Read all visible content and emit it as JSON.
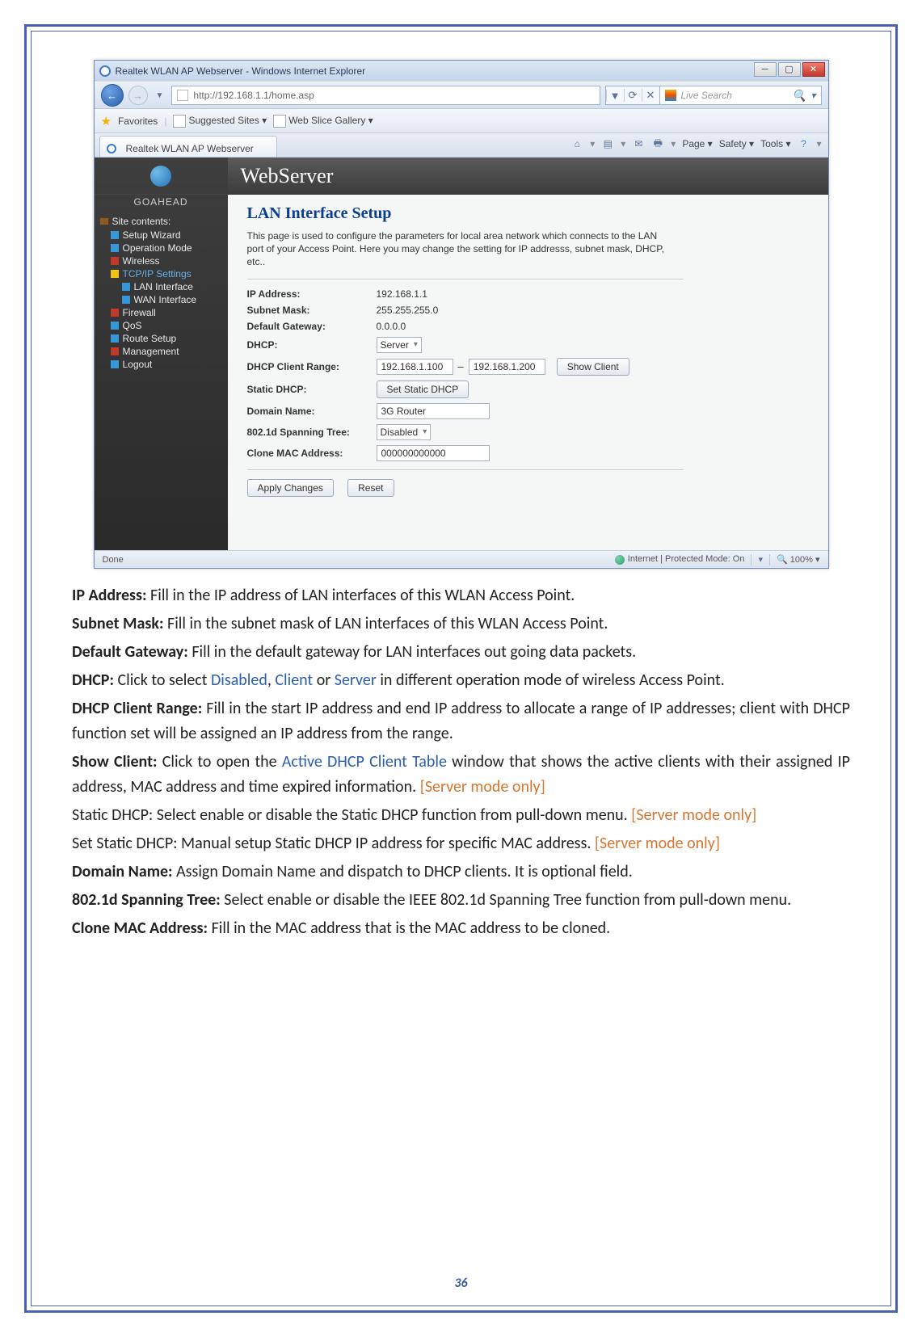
{
  "ie": {
    "window_title": "Realtek WLAN AP Webserver - Windows Internet Explorer",
    "url": "http://192.168.1.1/home.asp",
    "search_placeholder": "Live Search",
    "favorites_label": "Favorites",
    "fav_links": {
      "suggested": "Suggested Sites ▾",
      "gallery": "Web Slice Gallery ▾"
    },
    "tab_title": "Realtek WLAN AP Webserver",
    "cmd": {
      "page": "Page ▾",
      "safety": "Safety ▾",
      "tools": "Tools ▾"
    },
    "logo": "GOAHEAD",
    "header": "WebServer",
    "tree": {
      "root": "Site contents:",
      "items": [
        "Setup Wizard",
        "Operation Mode",
        "Wireless",
        "TCP/IP Settings",
        "LAN Interface",
        "WAN Interface",
        "Firewall",
        "QoS",
        "Route Setup",
        "Management",
        "Logout"
      ]
    },
    "page": {
      "title": "LAN Interface Setup",
      "desc": "This page is used to configure the parameters for local area network which connects to the LAN port of your Access Point. Here you may change the setting for IP addresss, subnet mask, DHCP, etc..",
      "rows": {
        "ip_label": "IP Address:",
        "ip_val": "192.168.1.1",
        "mask_label": "Subnet Mask:",
        "mask_val": "255.255.255.0",
        "gw_label": "Default Gateway:",
        "gw_val": "0.0.0.0",
        "dhcp_label": "DHCP:",
        "dhcp_val": "Server",
        "range_label": "DHCP Client Range:",
        "range_start": "192.168.1.100",
        "range_end": "192.168.1.200",
        "show_client": "Show Client",
        "static_label": "Static DHCP:",
        "static_btn": "Set Static DHCP",
        "domain_label": "Domain Name:",
        "domain_val": "3G Router",
        "stp_label": "802.1d Spanning Tree:",
        "stp_val": "Disabled",
        "mac_label": "Clone MAC Address:",
        "mac_val": "000000000000"
      },
      "apply": "Apply Changes",
      "reset": "Reset"
    },
    "status": {
      "done": "Done",
      "zone": "Internet | Protected Mode: On",
      "zoom": "100%"
    }
  },
  "doc": {
    "ip": {
      "b": "IP Address:",
      "t": " Fill in the IP address of LAN interfaces of this WLAN Access Point."
    },
    "mask": {
      "b": "Subnet Mask:",
      "t": " Fill in the subnet mask of LAN interfaces of this WLAN Access Point."
    },
    "gw": {
      "b": "Default Gateway:",
      "t": " Fill in the default gateway for LAN interfaces out going data packets."
    },
    "dhcp": {
      "b": "DHCP:",
      "t1": " Click to select ",
      "l1": "Disabled",
      "c1": ", ",
      "l2": "Client",
      "c2": " or ",
      "l3": "Server",
      "t2": " in different operation mode of wireless Access Point."
    },
    "range": {
      "b": "DHCP Client Range:",
      "t": " Fill in the start IP address and end IP address to allocate a range of IP addresses; client with DHCP function set will be assigned an IP address from the range."
    },
    "show": {
      "b": "Show Client:",
      "t1": " Click to open the ",
      "l1": "Active DHCP Client Table",
      "t2": " window that shows the active clients with their assigned IP address, MAC address and time expired information. ",
      "o": "[Server mode only]"
    },
    "static": {
      "t": "Static DHCP: Select enable or disable the Static DHCP function from pull-down menu. ",
      "o": "[Server mode only]"
    },
    "setstatic": {
      "t": "Set Static DHCP: Manual setup Static DHCP IP address for specific MAC address. ",
      "o": "[Server mode only]"
    },
    "domain": {
      "b": "Domain Name:",
      "t": " Assign Domain Name and dispatch to DHCP clients. It is optional field."
    },
    "stp": {
      "b": "802.1d Spanning Tree:",
      "t": " Select enable or disable the IEEE 802.1d Spanning Tree function from pull-down menu."
    },
    "mac": {
      "b": "Clone MAC Address:",
      "t": " Fill in the MAC address that is the MAC address to be cloned."
    }
  },
  "page_number": "36"
}
